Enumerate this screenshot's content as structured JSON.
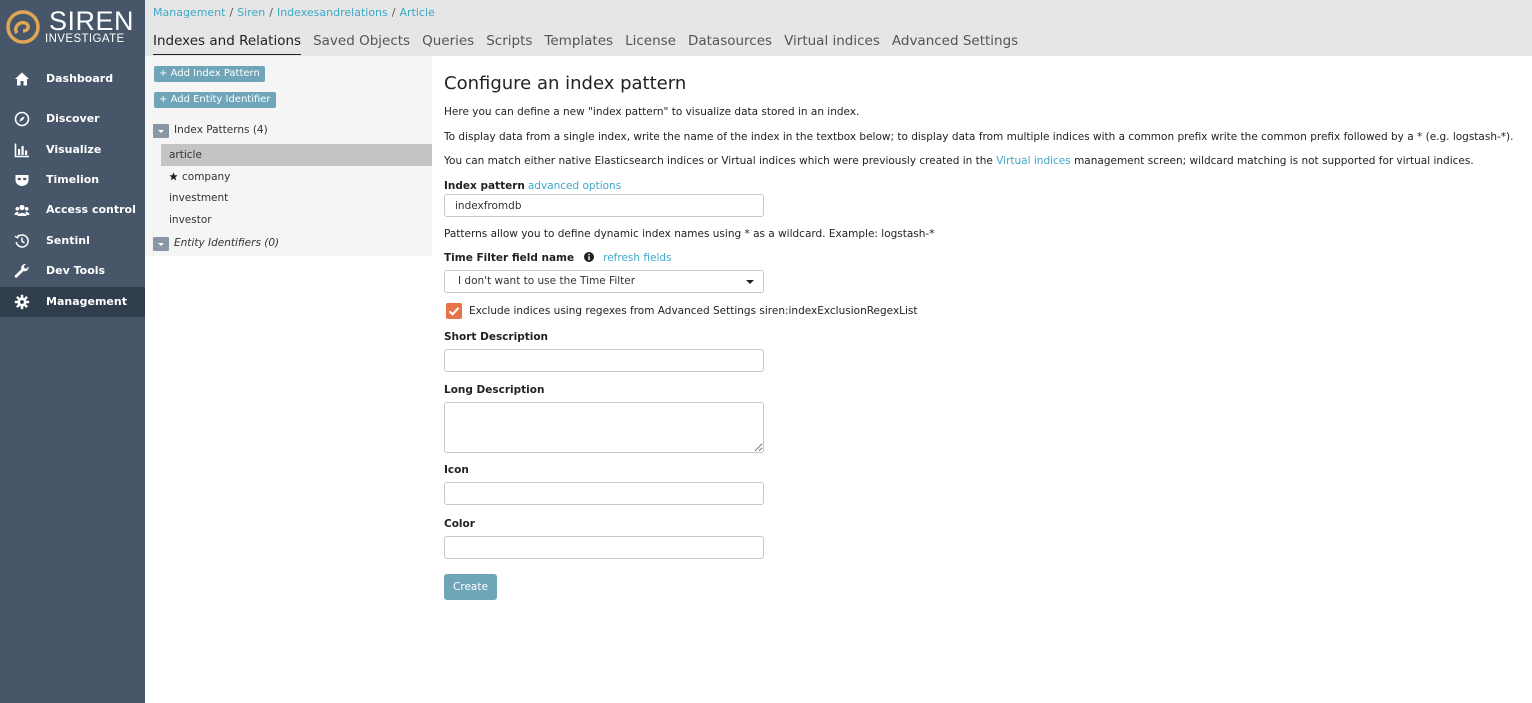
{
  "app": {
    "logo_name": "SIREN",
    "logo_subtitle": "INVESTIGATE",
    "accent_color": "#e0a655",
    "link_color": "#3ea8c6",
    "button_color": "#6fa5b8",
    "sidebar_color": "#475769"
  },
  "sidebar": {
    "items": [
      {
        "label": "Dashboard",
        "icon": "home-icon"
      },
      {
        "label": "Discover",
        "icon": "compass-icon"
      },
      {
        "label": "Visualize",
        "icon": "bar-chart-icon"
      },
      {
        "label": "Timelion",
        "icon": "timelion-mask-icon"
      },
      {
        "label": "Access control",
        "icon": "users-icon"
      },
      {
        "label": "Sentinl",
        "icon": "history-icon"
      },
      {
        "label": "Dev Tools",
        "icon": "wrench-icon"
      },
      {
        "label": "Management",
        "icon": "gear-icon",
        "active": true
      }
    ]
  },
  "breadcrumb": [
    "Management",
    "Siren",
    "Indexesandrelations",
    "Article"
  ],
  "tabs": [
    {
      "label": "Indexes and Relations",
      "active": true
    },
    {
      "label": "Saved Objects"
    },
    {
      "label": "Queries"
    },
    {
      "label": "Scripts"
    },
    {
      "label": "Templates"
    },
    {
      "label": "License"
    },
    {
      "label": "Datasources"
    },
    {
      "label": "Virtual indices"
    },
    {
      "label": "Advanced Settings"
    }
  ],
  "tree": {
    "add_index_pattern": "Add Index Pattern",
    "add_entity_identifier": "Add Entity Identifier",
    "index_patterns_label": "Index Patterns (4)",
    "index_patterns": [
      {
        "name": "article",
        "selected": true,
        "default": false
      },
      {
        "name": "company",
        "selected": false,
        "default": true
      },
      {
        "name": "investment",
        "selected": false,
        "default": false
      },
      {
        "name": "investor",
        "selected": false,
        "default": false
      }
    ],
    "entity_identifiers_label": "Entity Identifiers (0)"
  },
  "form": {
    "title": "Configure an index pattern",
    "intro": "Here you can define a new \"index pattern\" to visualize data stored in an index.",
    "instructions": "To display data from a single index, write the name of the index in the textbox below; to display data from multiple indices with a common prefix write the common prefix followed by a * (e.g. logstash-*).",
    "match_before": "You can match either native Elasticsearch indices or Virtual indices which were previously created in the",
    "match_link": "Virtual indices",
    "match_after": "management screen; wildcard matching is not supported for virtual indices.",
    "index_pattern_label": "Index pattern",
    "advanced_options": "advanced options",
    "index_pattern_value": "indexfromdb",
    "pattern_help": "Patterns allow you to define dynamic index names using * as a wildcard. Example: logstash-*",
    "time_filter_label": "Time Filter field name",
    "refresh_fields": "refresh fields",
    "time_filter_value": "I don't want to use the Time Filter",
    "exclude_label": "Exclude indices using regexes from Advanced Settings siren:indexExclusionRegexList",
    "exclude_checked": true,
    "short_description_label": "Short Description",
    "short_description_value": "",
    "long_description_label": "Long Description",
    "long_description_value": "",
    "icon_label": "Icon",
    "icon_value": "",
    "color_label": "Color",
    "color_value": "",
    "create_button": "Create"
  }
}
